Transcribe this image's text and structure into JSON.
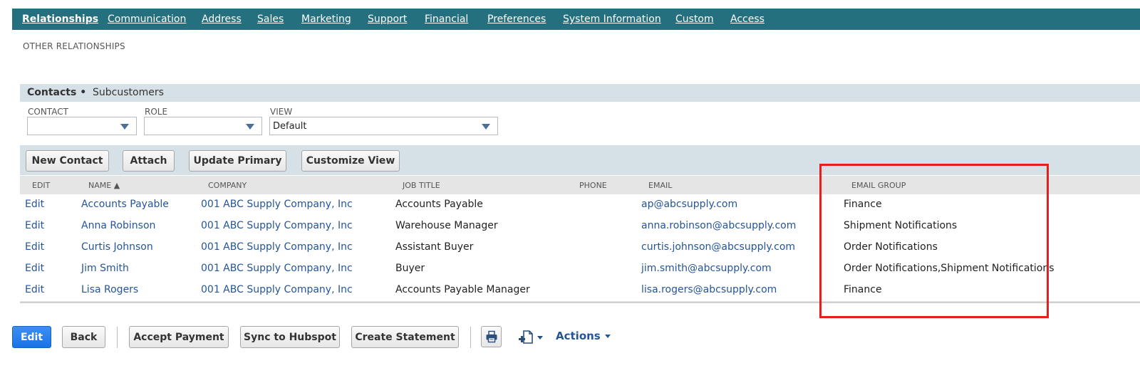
{
  "tabs": [
    {
      "label": "Relationships",
      "active": true
    },
    {
      "label": "Communication",
      "active": false
    },
    {
      "label": "Address",
      "active": false
    },
    {
      "label": "Sales",
      "active": false
    },
    {
      "label": "Marketing",
      "active": false
    },
    {
      "label": "Support",
      "active": false
    },
    {
      "label": "Financial",
      "active": false
    },
    {
      "label": "Preferences",
      "active": false
    },
    {
      "label": "System Information",
      "active": false
    },
    {
      "label": "Custom",
      "active": false
    },
    {
      "label": "Access",
      "active": false
    }
  ],
  "section_heading": "OTHER RELATIONSHIPS",
  "subtabs": [
    {
      "label": "Contacts •",
      "active": true
    },
    {
      "label": "Subcustomers",
      "active": false
    }
  ],
  "filters": {
    "contact": {
      "label": "CONTACT",
      "value": ""
    },
    "role": {
      "label": "ROLE",
      "value": ""
    },
    "view": {
      "label": "VIEW",
      "value": "Default"
    }
  },
  "list_buttons": {
    "new_contact": "New Contact",
    "attach": "Attach",
    "update_primary": "Update Primary",
    "customize_view": "Customize View"
  },
  "columns": {
    "edit": "EDIT",
    "name": "NAME ▲",
    "company": "COMPANY",
    "job_title": "JOB TITLE",
    "phone": "PHONE",
    "email": "EMAIL",
    "email_group": "EMAIL GROUP"
  },
  "rows": [
    {
      "edit": "Edit",
      "name": "Accounts Payable",
      "company": "001 ABC Supply Company, Inc",
      "job_title": "Accounts Payable",
      "phone": "",
      "email": "ap@abcsupply.com",
      "email_group": "Finance"
    },
    {
      "edit": "Edit",
      "name": "Anna Robinson",
      "company": "001 ABC Supply Company, Inc",
      "job_title": "Warehouse Manager",
      "phone": "",
      "email": "anna.robinson@abcsupply.com",
      "email_group": "Shipment Notifications"
    },
    {
      "edit": "Edit",
      "name": "Curtis Johnson",
      "company": "001 ABC Supply Company, Inc",
      "job_title": "Assistant Buyer",
      "phone": "",
      "email": "curtis.johnson@abcsupply.com",
      "email_group": "Order Notifications"
    },
    {
      "edit": "Edit",
      "name": "Jim Smith",
      "company": "001 ABC Supply Company, Inc",
      "job_title": "Buyer",
      "phone": "",
      "email": "jim.smith@abcsupply.com",
      "email_group": "Order Notifications,Shipment Notifications"
    },
    {
      "edit": "Edit",
      "name": "Lisa Rogers",
      "company": "001 ABC Supply Company, Inc",
      "job_title": "Accounts Payable Manager",
      "phone": "",
      "email": "lisa.rogers@abcsupply.com",
      "email_group": "Finance"
    }
  ],
  "footer": {
    "edit": "Edit",
    "back": "Back",
    "accept_payment": "Accept Payment",
    "sync_hubspot": "Sync to Hubspot",
    "create_statement": "Create Statement",
    "actions": "Actions"
  },
  "colors": {
    "tab_bar": "#25707e",
    "link": "#255599",
    "highlight": "#e81d1d",
    "primary_button": "#1a73e8"
  },
  "icons": [
    "printer-icon",
    "new-record-icon",
    "chevron-down-icon"
  ]
}
